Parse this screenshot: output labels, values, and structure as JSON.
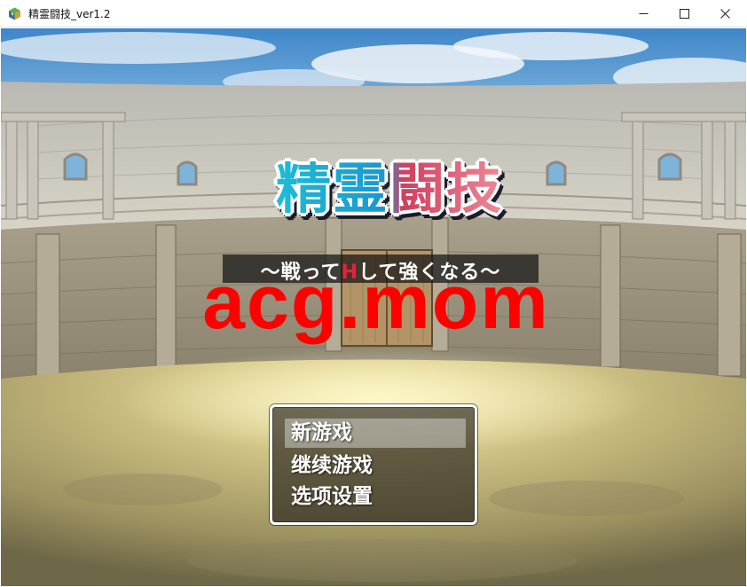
{
  "window": {
    "title": "精霊闘技_ver1.2",
    "icon": "rpg-maker-app-icon",
    "controls": [
      "minimize-icon",
      "maximize-icon",
      "close-icon"
    ]
  },
  "title_screen": {
    "logo": "精霊闘技",
    "subtitle": {
      "before": "～戦って",
      "highlight": "H",
      "after": "して強くなる～"
    },
    "watermark": "acg.mom"
  },
  "command_window": {
    "items": [
      {
        "label": "新游戏",
        "selected": true
      },
      {
        "label": "继续游戏",
        "selected": false
      },
      {
        "label": "选项设置",
        "selected": false
      }
    ]
  },
  "colors": {
    "logo_left": "#1fc6d8",
    "logo_right": "#d23f5e",
    "subtitle_highlight": "#e8213a",
    "watermark": "#ff0000",
    "window_border": "#ffffff"
  }
}
